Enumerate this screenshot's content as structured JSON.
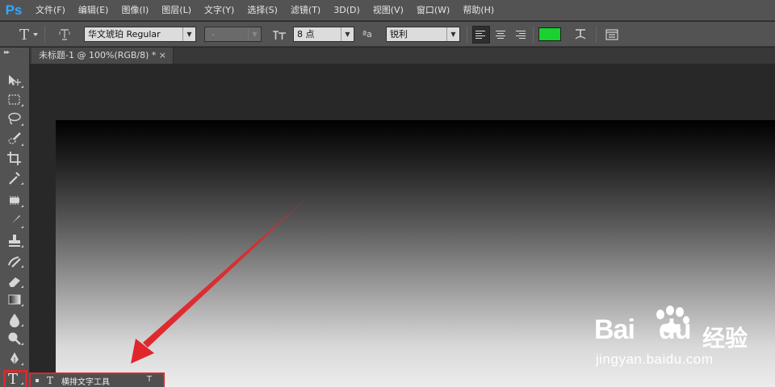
{
  "app": {
    "logo": "Ps"
  },
  "menu": [
    "文件(F)",
    "编辑(E)",
    "图像(I)",
    "图层(L)",
    "文字(Y)",
    "选择(S)",
    "滤镜(T)",
    "3D(D)",
    "视图(V)",
    "窗口(W)",
    "帮助(H)"
  ],
  "options": {
    "font_family": "华文琥珀 Regular",
    "font_style": "-",
    "font_size": "8 点",
    "antialias_label": "ªa",
    "antialias": "锐利",
    "text_color": "#19d230"
  },
  "document": {
    "tab_title": "未标题-1 @ 100%(RGB/8) *",
    "close": "×"
  },
  "tools": [
    "move-icon",
    "marquee-icon",
    "lasso-icon",
    "quick-select-icon",
    "crop-icon",
    "eyedropper-icon",
    "healing-brush-icon",
    "brush-icon",
    "clone-stamp-icon",
    "history-brush-icon",
    "eraser-icon",
    "gradient-icon",
    "blur-icon",
    "dodge-icon",
    "pen-icon",
    "type-icon"
  ],
  "flyout": {
    "glyph": "T",
    "label": "横排文字工具",
    "shortcut": "T"
  },
  "watermark": {
    "brand": "Bai",
    "brand2": "du",
    "cn": "经验",
    "url": "jingyan.baidu.com"
  },
  "colors": {
    "highlight": "#e0262b",
    "accent": "#31a8ff"
  }
}
